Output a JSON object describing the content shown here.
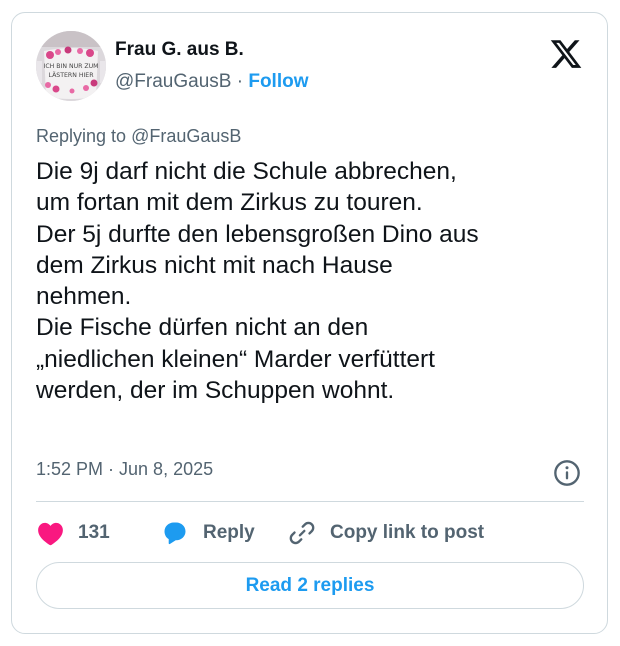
{
  "author": {
    "name": "Frau G. aus B.",
    "handle": "@FrauGausB",
    "separator": "·",
    "follow_label": "Follow",
    "avatar_icon": "mug-avatar",
    "avatar_text_line1": "ICH BIN NUR ZUM",
    "avatar_text_line2": "LÄSTERN HIER"
  },
  "brand": {
    "logo_icon": "x-logo"
  },
  "replying": {
    "prefix": "Replying to ",
    "mention": "@FrauGausB"
  },
  "tweet": {
    "lines": [
      "Die 9j darf nicht die Schule abbrechen,",
      "um fortan mit dem Zirkus zu touren.",
      "Der 5j durfte den lebensgroßen Dino aus",
      "dem Zirkus nicht mit nach Hause",
      "nehmen.",
      "Die Fische dürfen nicht an den",
      "„niedlichen kleinen“ Marder verfüttert",
      "werden, der im Schuppen wohnt."
    ]
  },
  "meta": {
    "timestamp": "1:52 PM · Jun 8, 2025",
    "info_icon": "info-icon"
  },
  "actions": {
    "like_count": "131",
    "reply_label": "Reply",
    "copy_label": "Copy link to post"
  },
  "footer": {
    "read_replies_label": "Read 2 replies"
  },
  "colors": {
    "accent": "#1d9bf0",
    "like": "#f91880",
    "text": "#0f1419",
    "muted": "#536471",
    "border": "#cfd9de"
  }
}
